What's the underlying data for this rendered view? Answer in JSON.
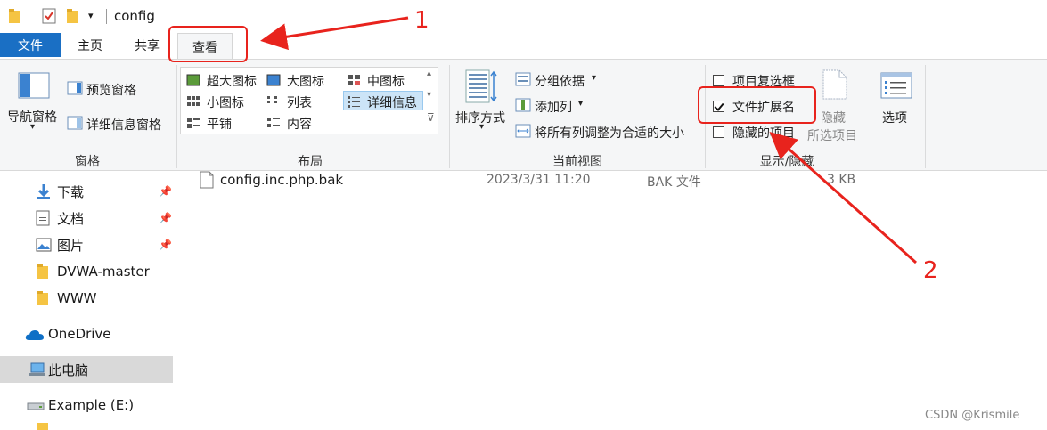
{
  "window": {
    "title": "config"
  },
  "tabs": {
    "file": "文件",
    "home": "主页",
    "share": "共享",
    "view": "查看"
  },
  "ribbon": {
    "panes": {
      "nav_pane": "导航窗格",
      "preview_pane": "预览窗格",
      "details_pane": "详细信息窗格",
      "group_label": "窗格"
    },
    "layout": {
      "extra_large": "超大图标",
      "large": "大图标",
      "medium": "中图标",
      "small": "小图标",
      "list": "列表",
      "details": "详细信息",
      "tiles": "平铺",
      "content": "内容",
      "group_label": "布局"
    },
    "current_view": {
      "sort_by": "排序方式",
      "group_by": "分组依据",
      "add_columns": "添加列",
      "size_all_columns": "将所有列调整为合适的大小",
      "group_label": "当前视图"
    },
    "show_hide": {
      "item_checkboxes": "项目复选框",
      "item_checkboxes_checked": false,
      "file_extensions": "文件扩展名",
      "file_extensions_checked": true,
      "hidden_items": "隐藏的项目",
      "hidden_items_checked": false,
      "hide_selected_line1": "隐藏",
      "hide_selected_line2": "所选项目",
      "group_label": "显示/隐藏"
    },
    "options": "选项"
  },
  "nav": {
    "items": [
      {
        "label": "下载",
        "icon": "download-arrow-icon",
        "pinned": true
      },
      {
        "label": "文档",
        "icon": "document-icon",
        "pinned": true
      },
      {
        "label": "图片",
        "icon": "picture-icon",
        "pinned": true
      },
      {
        "label": "DVWA-master",
        "icon": "folder-icon",
        "pinned": false
      },
      {
        "label": "WWW",
        "icon": "folder-icon",
        "pinned": false
      },
      {
        "label": "OneDrive",
        "icon": "cloud-icon",
        "pinned": false
      },
      {
        "label": "此电脑",
        "icon": "computer-icon",
        "pinned": false
      },
      {
        "label": "Example (E:)",
        "icon": "drive-icon",
        "pinned": false
      }
    ]
  },
  "file": {
    "name": "config.inc.php.bak",
    "date": "2023/3/31 11:20",
    "type": "BAK 文件",
    "size": "3 KB"
  },
  "annotations": {
    "one": "1",
    "two": "2"
  },
  "watermark": "CSDN @Krismile",
  "colors": {
    "file_tab": "#1a6fc4",
    "annotation": "#e8231d",
    "selection": "#cce4f7"
  }
}
